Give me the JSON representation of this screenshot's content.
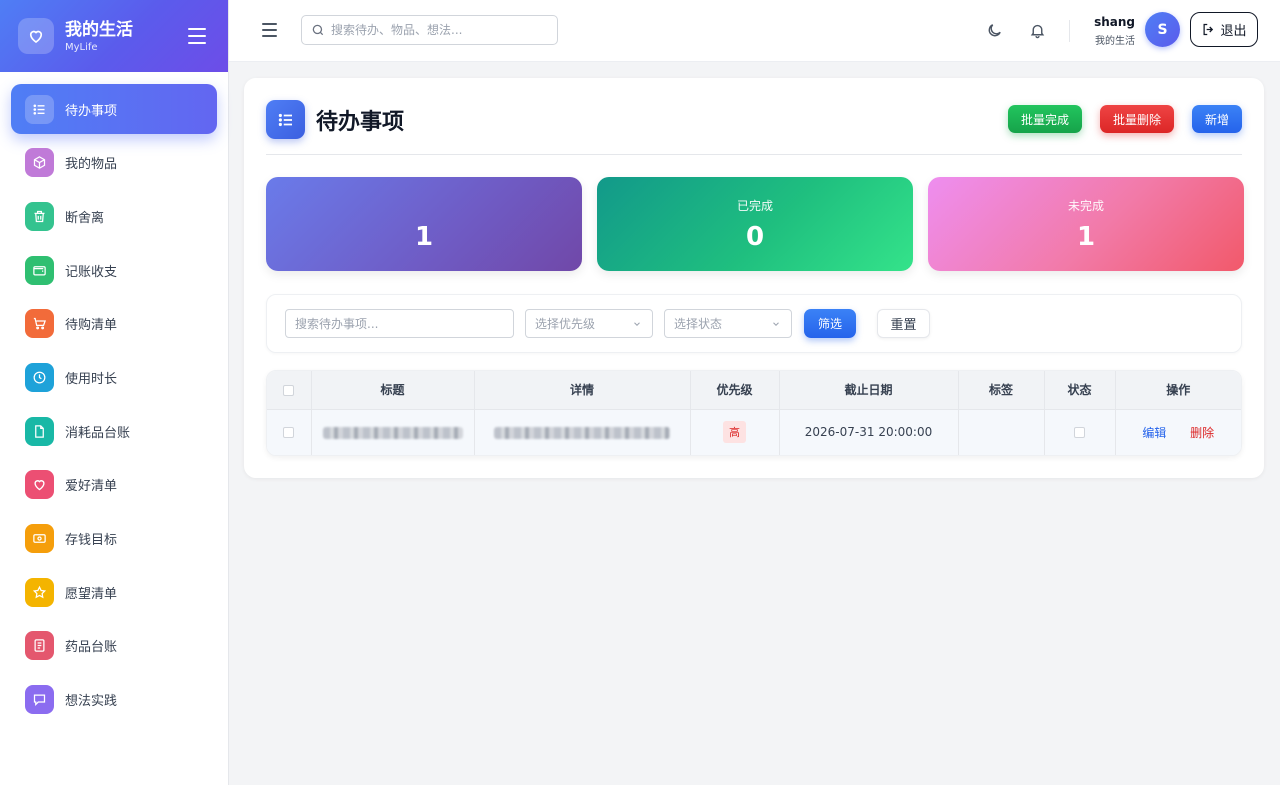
{
  "brand": {
    "title": "我的生活",
    "subtitle": "MyLife"
  },
  "sidebar": {
    "items": [
      {
        "label": "待办事项",
        "icon": "list-icon",
        "color": "#4f7ef5",
        "active": true
      },
      {
        "label": "我的物品",
        "icon": "box-icon",
        "color": "#c07ad8"
      },
      {
        "label": "断舍离",
        "icon": "trash-icon",
        "color": "#34c38f"
      },
      {
        "label": "记账收支",
        "icon": "wallet-icon",
        "color": "#2fbf71"
      },
      {
        "label": "待购清单",
        "icon": "cart-icon",
        "color": "#f26b3a"
      },
      {
        "label": "使用时长",
        "icon": "clock-icon",
        "color": "#1ea2d9"
      },
      {
        "label": "消耗品台账",
        "icon": "document-icon",
        "color": "#19b8a6"
      },
      {
        "label": "爱好清单",
        "icon": "heart-icon",
        "color": "#ec4f73"
      },
      {
        "label": "存钱目标",
        "icon": "money-icon",
        "color": "#f59e0b"
      },
      {
        "label": "愿望清单",
        "icon": "star-icon",
        "color": "#f4b400"
      },
      {
        "label": "药品台账",
        "icon": "notebook-icon",
        "color": "#e4576e"
      },
      {
        "label": "想法实践",
        "icon": "chat-icon",
        "color": "#8b6cf0"
      }
    ]
  },
  "topbar": {
    "search_placeholder": "搜索待办、物品、想法...",
    "user_name": "shang",
    "user_sub": "我的生活",
    "avatar_letter": "S",
    "logout_label": "退出"
  },
  "page": {
    "title": "待办事项",
    "actions": {
      "batch_complete": "批量完成",
      "batch_delete": "批量删除",
      "add": "新增"
    },
    "stats": [
      {
        "label": "",
        "value": "1"
      },
      {
        "label": "已完成",
        "value": "0"
      },
      {
        "label": "未完成",
        "value": "1"
      }
    ],
    "filter": {
      "search_placeholder": "搜索待办事项...",
      "priority_placeholder": "选择优先级",
      "status_placeholder": "选择状态",
      "filter_button": "筛选",
      "reset_button": "重置"
    },
    "table": {
      "columns": [
        "标题",
        "详情",
        "优先级",
        "截止日期",
        "标签",
        "状态",
        "操作"
      ],
      "rows": [
        {
          "priority": "高",
          "deadline": "2026-07-31 20:00:00",
          "tag": "",
          "edit": "编辑",
          "delete": "删除"
        }
      ]
    }
  },
  "colors": {
    "accent": "#4f7ef5",
    "success": "#16a34a",
    "danger": "#dc2626"
  }
}
